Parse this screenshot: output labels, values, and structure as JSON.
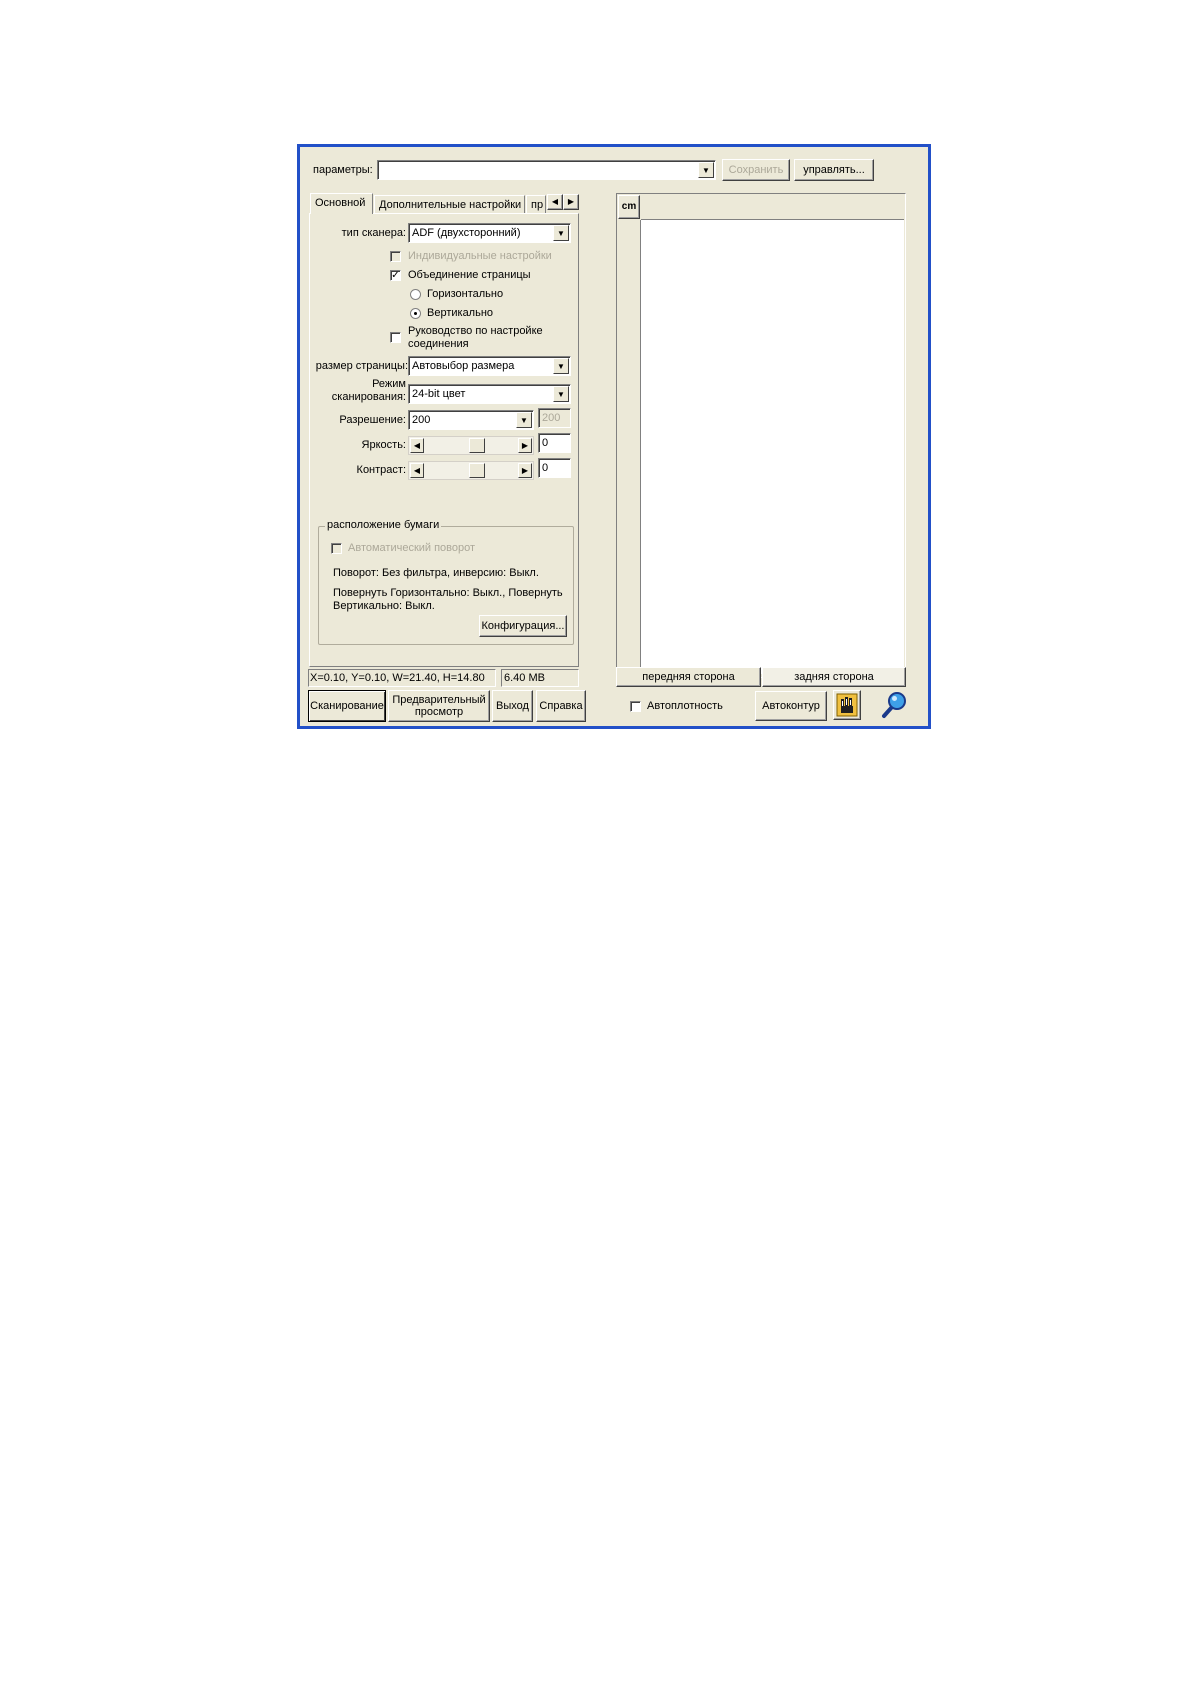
{
  "toolbar": {
    "params_label": "параметры:",
    "params_value": "",
    "save_label": "Сохранить",
    "manage_label": "управлять..."
  },
  "tabs": [
    {
      "label": "Основной",
      "active": true
    },
    {
      "label": "Дополнительные настройки"
    },
    {
      "label": "пр"
    }
  ],
  "basic": {
    "scanner_type_label": "тип сканера:",
    "scanner_type_value": "ADF (двухсторонний)",
    "individual_settings_label": "Индивидуальные настройки",
    "page_merge_label": "Объединение страницы",
    "page_merge_checked": true,
    "horizontal_label": "Горизонтально",
    "vertical_label": "Вертикально",
    "orientation_selected": "vertical",
    "guide_label_line1": "Руководство по настройке",
    "guide_label_line2": "соединения",
    "page_size_label": "размер страницы:",
    "page_size_value": "Автовыбор размера",
    "scan_mode_label_line1": "Режим",
    "scan_mode_label_line2": "сканирования:",
    "scan_mode_value": "24-bit цвет",
    "resolution_label": "Разрешение:",
    "resolution_value": "200",
    "resolution_custom": "200",
    "brightness_label": "Яркость:",
    "brightness_value": "0",
    "contrast_label": "Контраст:",
    "contrast_value": "0"
  },
  "paper": {
    "group_label": "расположение бумаги",
    "auto_rotate_label": "Автоматический поворот",
    "rotation_text": "Поворот: Без фильтра, инверсию: Выкл.",
    "flip_text_line1": "Повернуть Горизонтально: Выкл., Повернуть",
    "flip_text_line2": "Вертикально: Выкл.",
    "config_label": "Конфигурация..."
  },
  "status": {
    "coords": "X=0.10, Y=0.10, W=21.40, H=14.80",
    "size": "6.40 MB"
  },
  "actions": {
    "scan_label": "Сканирование",
    "preview_line1": "Предварительный",
    "preview_line2": "просмотр",
    "exit_label": "Выход",
    "help_label": "Справка"
  },
  "preview": {
    "ruler_unit": "cm",
    "front_label": "передняя сторона",
    "back_label": "задняя сторона",
    "auto_density_label": "Автоплотность",
    "auto_contour_label": "Автоконтур",
    "hand_tool_icon": "hand-icon",
    "zoom_tool_icon": "magnifier-icon"
  }
}
